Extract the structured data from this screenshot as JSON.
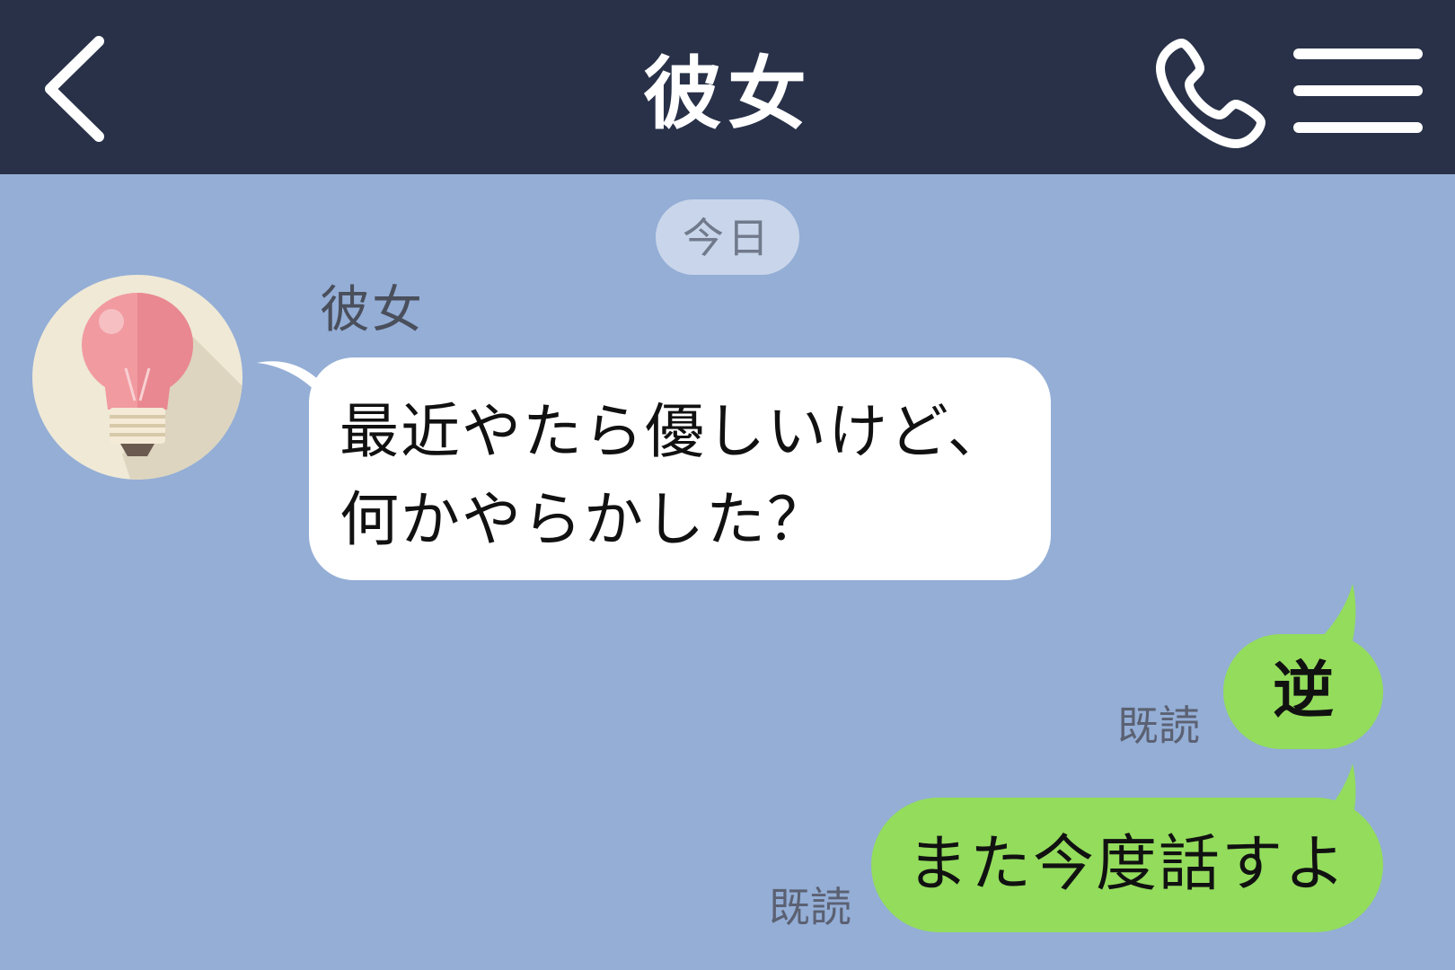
{
  "header": {
    "title": "彼女",
    "back_icon": "chevron-left-icon",
    "call_icon": "phone-icon",
    "menu_icon": "hamburger-menu-icon",
    "background_color": "#283148"
  },
  "chat": {
    "background_color": "#94aed6",
    "date_separator": "今日",
    "messages": [
      {
        "direction": "incoming",
        "sender": "彼女",
        "avatar_icon": "light-bulb-icon",
        "text_lines": [
          "最近やたら優しいけど、",
          "何かやらかした？"
        ]
      },
      {
        "direction": "outgoing",
        "text": "逆",
        "read_label": "既読"
      },
      {
        "direction": "outgoing",
        "text": "また今度話すよ",
        "read_label": "既読"
      }
    ]
  },
  "colors": {
    "incoming_bubble": "#ffffff",
    "outgoing_bubble": "#93dc5c",
    "date_chip": "#c9d5ea"
  }
}
